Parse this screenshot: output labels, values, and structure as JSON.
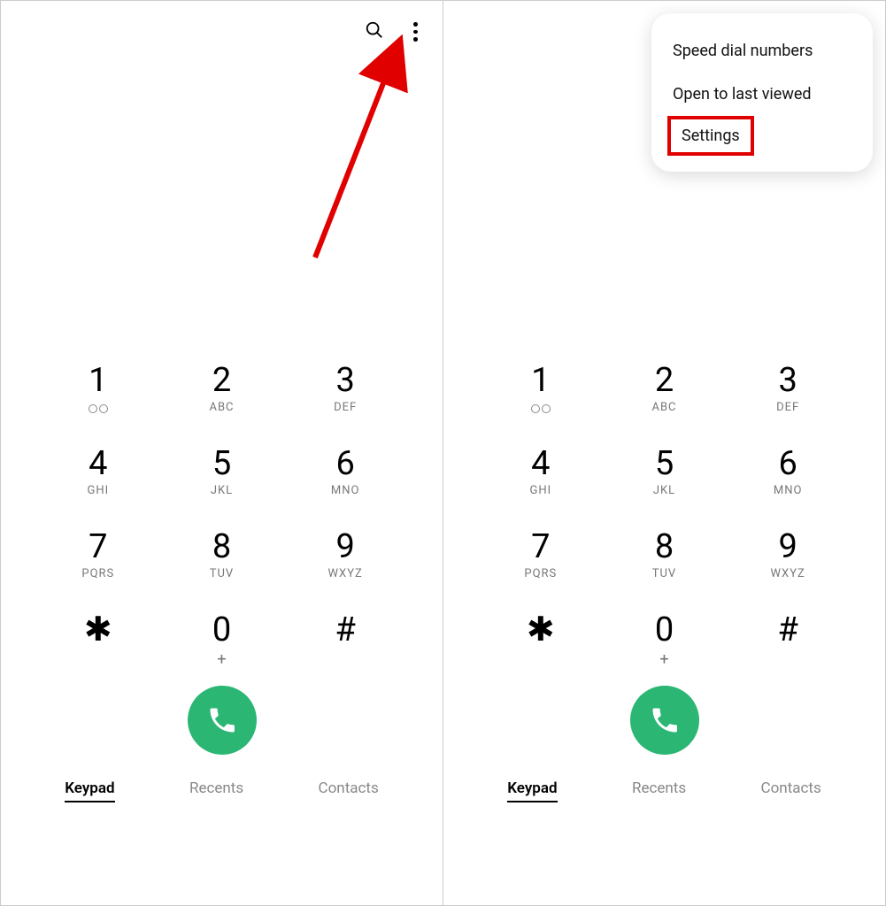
{
  "keys": [
    {
      "digit": "1",
      "sub": ""
    },
    {
      "digit": "2",
      "sub": "ABC"
    },
    {
      "digit": "3",
      "sub": "DEF"
    },
    {
      "digit": "4",
      "sub": "GHI"
    },
    {
      "digit": "5",
      "sub": "JKL"
    },
    {
      "digit": "6",
      "sub": "MNO"
    },
    {
      "digit": "7",
      "sub": "PQRS"
    },
    {
      "digit": "8",
      "sub": "TUV"
    },
    {
      "digit": "9",
      "sub": "WXYZ"
    },
    {
      "digit": "✱",
      "sub": ""
    },
    {
      "digit": "0",
      "sub": "+"
    },
    {
      "digit": "#",
      "sub": ""
    }
  ],
  "tabs": {
    "keypad": "Keypad",
    "recents": "Recents",
    "contacts": "Contacts"
  },
  "menu": {
    "speed_dial": "Speed dial numbers",
    "open_last": "Open to last viewed",
    "settings": "Settings"
  },
  "colors": {
    "call_button": "#2bb673",
    "annotation": "#e00000"
  }
}
